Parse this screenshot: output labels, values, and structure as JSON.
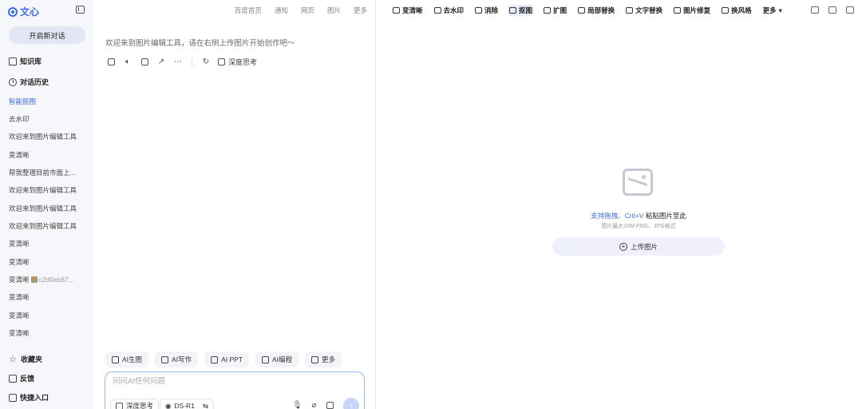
{
  "sidebar": {
    "logo_text": "文心",
    "new_chat": "开启新对话",
    "knowledge": "知识库",
    "history_label": "对话历史",
    "history": [
      {
        "label": "智能抠图",
        "active": true
      },
      {
        "label": "去水印"
      },
      {
        "label": "欢迎来到图片编辑工具"
      },
      {
        "label": "变清晰"
      },
      {
        "label": "帮我整理目前市面上..."
      },
      {
        "label": "欢迎来到图片编辑工具"
      },
      {
        "label": "欢迎来到图片编辑工具"
      },
      {
        "label": "欢迎来到图片编辑工具"
      },
      {
        "label": "变清晰"
      },
      {
        "label": "变清晰"
      },
      {
        "label": "变清晰",
        "suffix": "c2d0eb67..."
      },
      {
        "label": "变清晰"
      },
      {
        "label": "变清晰"
      },
      {
        "label": "变清晰"
      }
    ],
    "favorites": "收藏夹",
    "feedback": "反馈",
    "quick_entry": "快捷入口"
  },
  "chat": {
    "top_links": [
      "百度首页",
      "通知",
      "网页",
      "图片",
      "更多"
    ],
    "welcome": "欢迎来到图片编辑工具，请在右侧上传图片开始创作吧～",
    "deep_think": "深度思考",
    "chips": [
      "AI生图",
      "AI写作",
      "AI PPT",
      "AI编程",
      "更多"
    ],
    "composer": {
      "placeholder": "问问AI任何问题",
      "deep_think": "深度思考",
      "model": "DS-R1"
    }
  },
  "editor": {
    "tools": [
      "变清晰",
      "去水印",
      "消除",
      "抠图",
      "扩图",
      "局部替换",
      "文字替换",
      "图片修复",
      "换风格",
      "更多"
    ],
    "active_tool": "抠图",
    "drop_title_blue": "支持拖拽、Crtl+V",
    "drop_title_rest": " 粘贴图片至此",
    "drop_sub": "图片最大10M PNG、JPG格式",
    "upload": "上传图片"
  },
  "colors": {
    "accent": "#3b6cf6",
    "sidebar_bg": "#f6f7fb"
  }
}
